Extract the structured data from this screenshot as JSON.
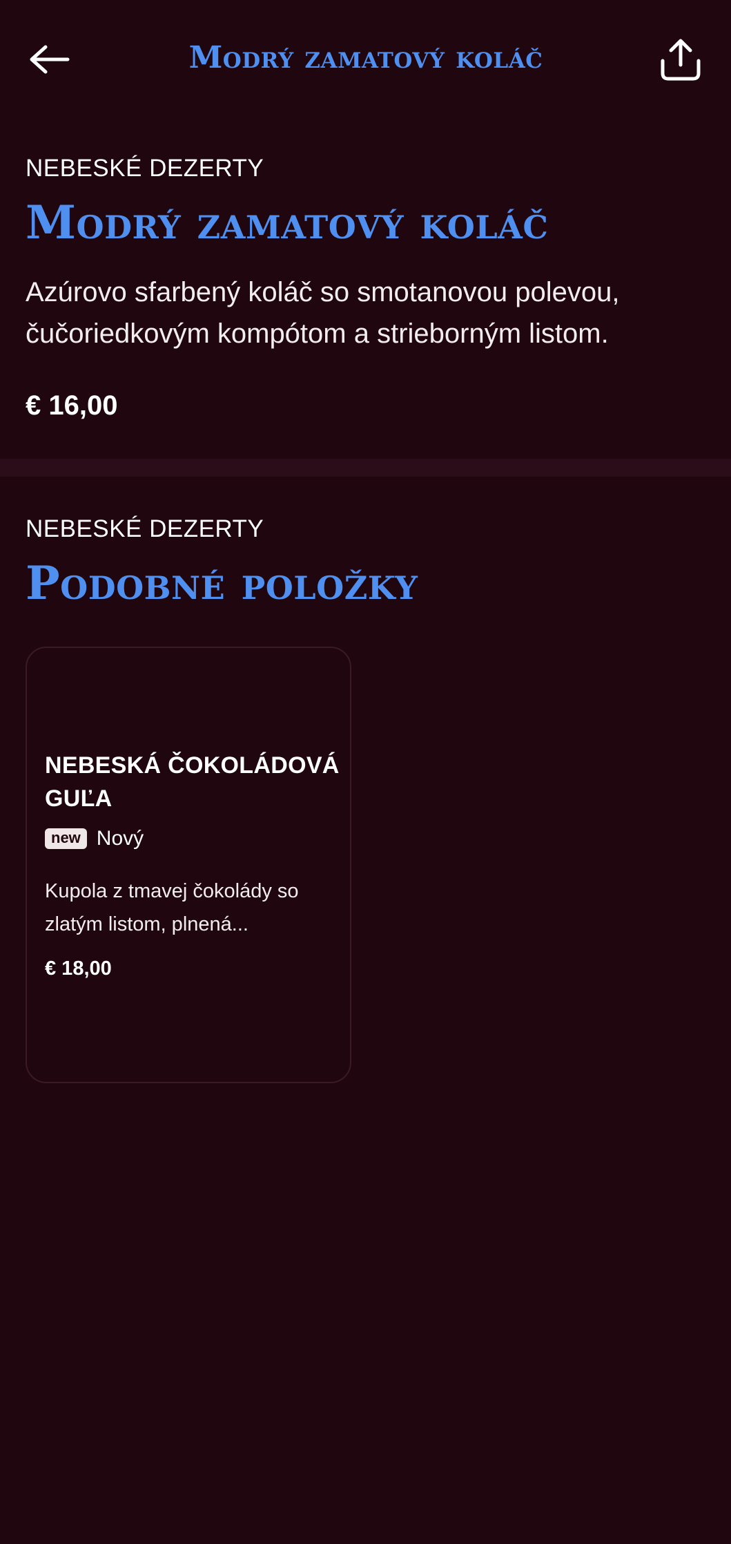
{
  "header": {
    "title": "Modrý zamatový koláč",
    "back_icon": "arrow-left-icon",
    "share_icon": "share-icon"
  },
  "product": {
    "category": "NEBESKÉ DEZERTY",
    "title": "Modrý zamatový koláč",
    "description": "Azúrovo sfarbený koláč so smotanovou polevou, čučoriedkovým kompótom a strieborným listom.",
    "price": "€ 16,00"
  },
  "similar": {
    "category": "NEBESKÉ DEZERTY",
    "title": "Podobné položky",
    "items": [
      {
        "title": "NEBESKÁ ČOKOLÁDOVÁ GUĽA",
        "badge": "new",
        "badge_label": "Nový",
        "description": "Kupola z tmavej čokolády so zlatým listom, plnená...",
        "price": "€ 18,00"
      }
    ]
  },
  "colors": {
    "background": "#20060f",
    "accent": "#4f8ff0",
    "divider": "#2a0d18"
  }
}
